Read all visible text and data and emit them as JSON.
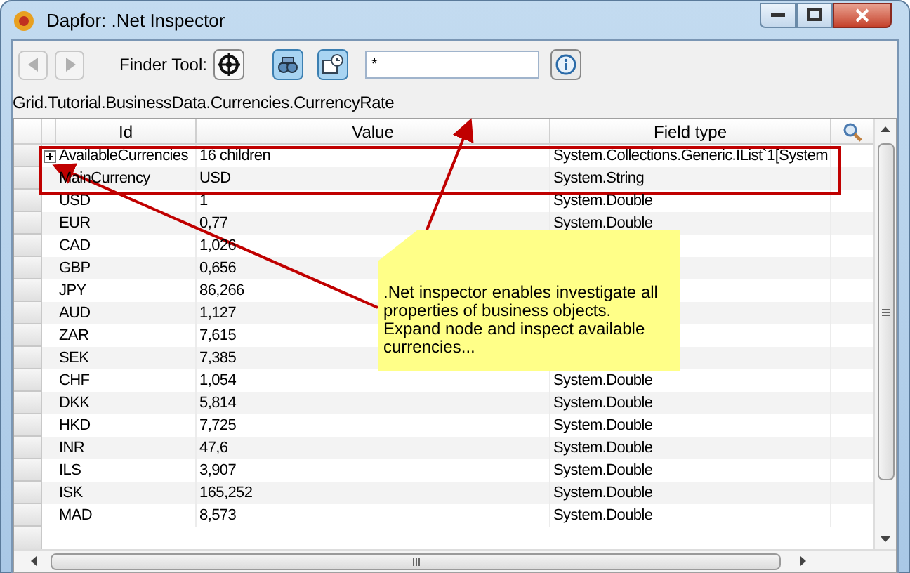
{
  "window": {
    "title": "Dapfor: .Net Inspector"
  },
  "toolbar": {
    "finder_label": "Finder Tool:",
    "search_value": "*"
  },
  "path": "Grid.Tutorial.BusinessData.Currencies.CurrencyRate",
  "table": {
    "columns": [
      "Id",
      "Value",
      "Field type"
    ],
    "rows": [
      {
        "id": "AvailableCurrencies",
        "value": "16 children",
        "field_type": "System.Collections.Generic.IList`1[System",
        "expandable": true
      },
      {
        "id": "MainCurrency",
        "value": "USD",
        "field_type": "System.String",
        "expandable": false
      },
      {
        "id": "USD",
        "value": "1",
        "field_type": "System.Double",
        "expandable": false
      },
      {
        "id": "EUR",
        "value": "0,77",
        "field_type": "System.Double",
        "expandable": false
      },
      {
        "id": "CAD",
        "value": "1,026",
        "expandable": false
      },
      {
        "id": "GBP",
        "value": "0,656",
        "expandable": false
      },
      {
        "id": "JPY",
        "value": "86,266",
        "expandable": false
      },
      {
        "id": "AUD",
        "value": "1,127",
        "expandable": false
      },
      {
        "id": "ZAR",
        "value": "7,615",
        "expandable": false
      },
      {
        "id": "SEK",
        "value": "7,385",
        "expandable": false
      },
      {
        "id": "CHF",
        "value": "1,054",
        "field_type": "System.Double",
        "expandable": false
      },
      {
        "id": "DKK",
        "value": "5,814",
        "field_type": "System.Double",
        "expandable": false
      },
      {
        "id": "HKD",
        "value": "7,725",
        "field_type": "System.Double",
        "expandable": false
      },
      {
        "id": "INR",
        "value": "47,6",
        "field_type": "System.Double",
        "expandable": false
      },
      {
        "id": "ILS",
        "value": "3,907",
        "field_type": "System.Double",
        "expandable": false
      },
      {
        "id": "ISK",
        "value": "165,252",
        "field_type": "System.Double",
        "expandable": false
      },
      {
        "id": "MAD",
        "value": "8,573",
        "field_type": "System.Double",
        "expandable": false
      }
    ]
  },
  "callout": {
    "text": ".Net inspector enables investigate all properties of business objects. Expand node and inspect available currencies..."
  }
}
